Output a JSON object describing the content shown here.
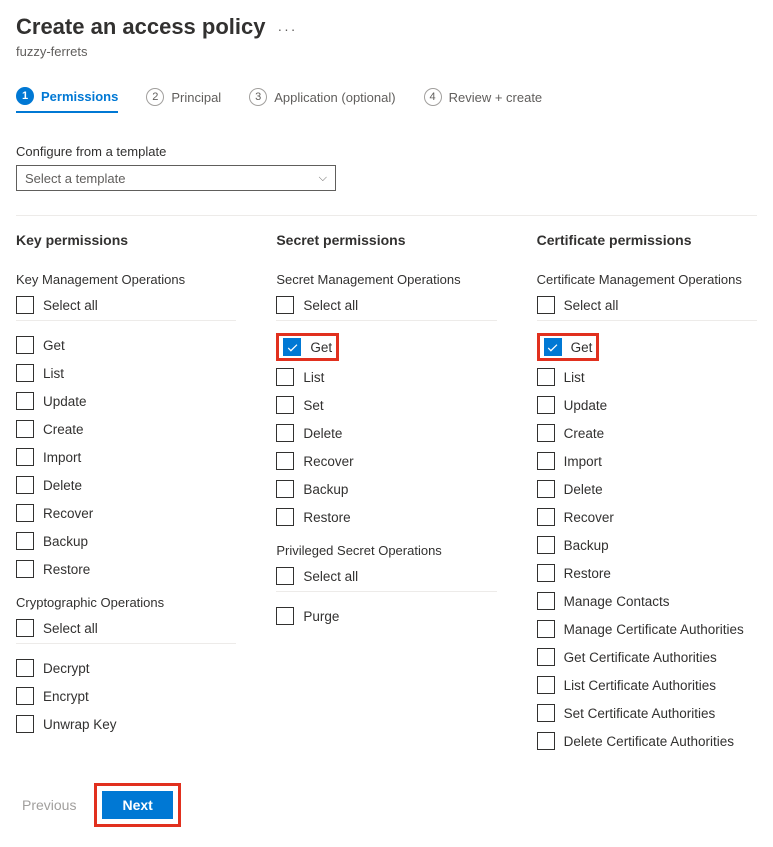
{
  "header": {
    "title": "Create an access policy",
    "subtitle": "fuzzy-ferrets"
  },
  "tabs": [
    {
      "num": "1",
      "label": "Permissions",
      "active": true
    },
    {
      "num": "2",
      "label": "Principal",
      "active": false
    },
    {
      "num": "3",
      "label": "Application (optional)",
      "active": false
    },
    {
      "num": "4",
      "label": "Review + create",
      "active": false
    }
  ],
  "template": {
    "label": "Configure from a template",
    "placeholder": "Select a template"
  },
  "columns": [
    {
      "title": "Key permissions",
      "groups": [
        {
          "title": "Key Management Operations",
          "select_all_label": "Select all",
          "items": [
            {
              "label": "Get",
              "checked": false,
              "highlight": false
            },
            {
              "label": "List",
              "checked": false
            },
            {
              "label": "Update",
              "checked": false
            },
            {
              "label": "Create",
              "checked": false
            },
            {
              "label": "Import",
              "checked": false
            },
            {
              "label": "Delete",
              "checked": false
            },
            {
              "label": "Recover",
              "checked": false
            },
            {
              "label": "Backup",
              "checked": false
            },
            {
              "label": "Restore",
              "checked": false
            }
          ]
        },
        {
          "title": "Cryptographic Operations",
          "select_all_label": "Select all",
          "items": [
            {
              "label": "Decrypt",
              "checked": false
            },
            {
              "label": "Encrypt",
              "checked": false
            },
            {
              "label": "Unwrap Key",
              "checked": false
            }
          ]
        }
      ]
    },
    {
      "title": "Secret permissions",
      "groups": [
        {
          "title": "Secret Management Operations",
          "select_all_label": "Select all",
          "items": [
            {
              "label": "Get",
              "checked": true,
              "highlight": true
            },
            {
              "label": "List",
              "checked": false
            },
            {
              "label": "Set",
              "checked": false
            },
            {
              "label": "Delete",
              "checked": false
            },
            {
              "label": "Recover",
              "checked": false
            },
            {
              "label": "Backup",
              "checked": false
            },
            {
              "label": "Restore",
              "checked": false
            }
          ]
        },
        {
          "title": "Privileged Secret Operations",
          "select_all_label": "Select all",
          "items": [
            {
              "label": "Purge",
              "checked": false
            }
          ]
        }
      ]
    },
    {
      "title": "Certificate permissions",
      "groups": [
        {
          "title": "Certificate Management Operations",
          "select_all_label": "Select all",
          "items": [
            {
              "label": "Get",
              "checked": true,
              "highlight": true
            },
            {
              "label": "List",
              "checked": false
            },
            {
              "label": "Update",
              "checked": false
            },
            {
              "label": "Create",
              "checked": false
            },
            {
              "label": "Import",
              "checked": false
            },
            {
              "label": "Delete",
              "checked": false
            },
            {
              "label": "Recover",
              "checked": false
            },
            {
              "label": "Backup",
              "checked": false
            },
            {
              "label": "Restore",
              "checked": false
            },
            {
              "label": "Manage Contacts",
              "checked": false
            },
            {
              "label": "Manage Certificate Authorities",
              "checked": false
            },
            {
              "label": "Get Certificate Authorities",
              "checked": false
            },
            {
              "label": "List Certificate Authorities",
              "checked": false
            },
            {
              "label": "Set Certificate Authorities",
              "checked": false
            },
            {
              "label": "Delete Certificate Authorities",
              "checked": false
            }
          ]
        }
      ]
    }
  ],
  "footer": {
    "previous": "Previous",
    "next": "Next"
  }
}
